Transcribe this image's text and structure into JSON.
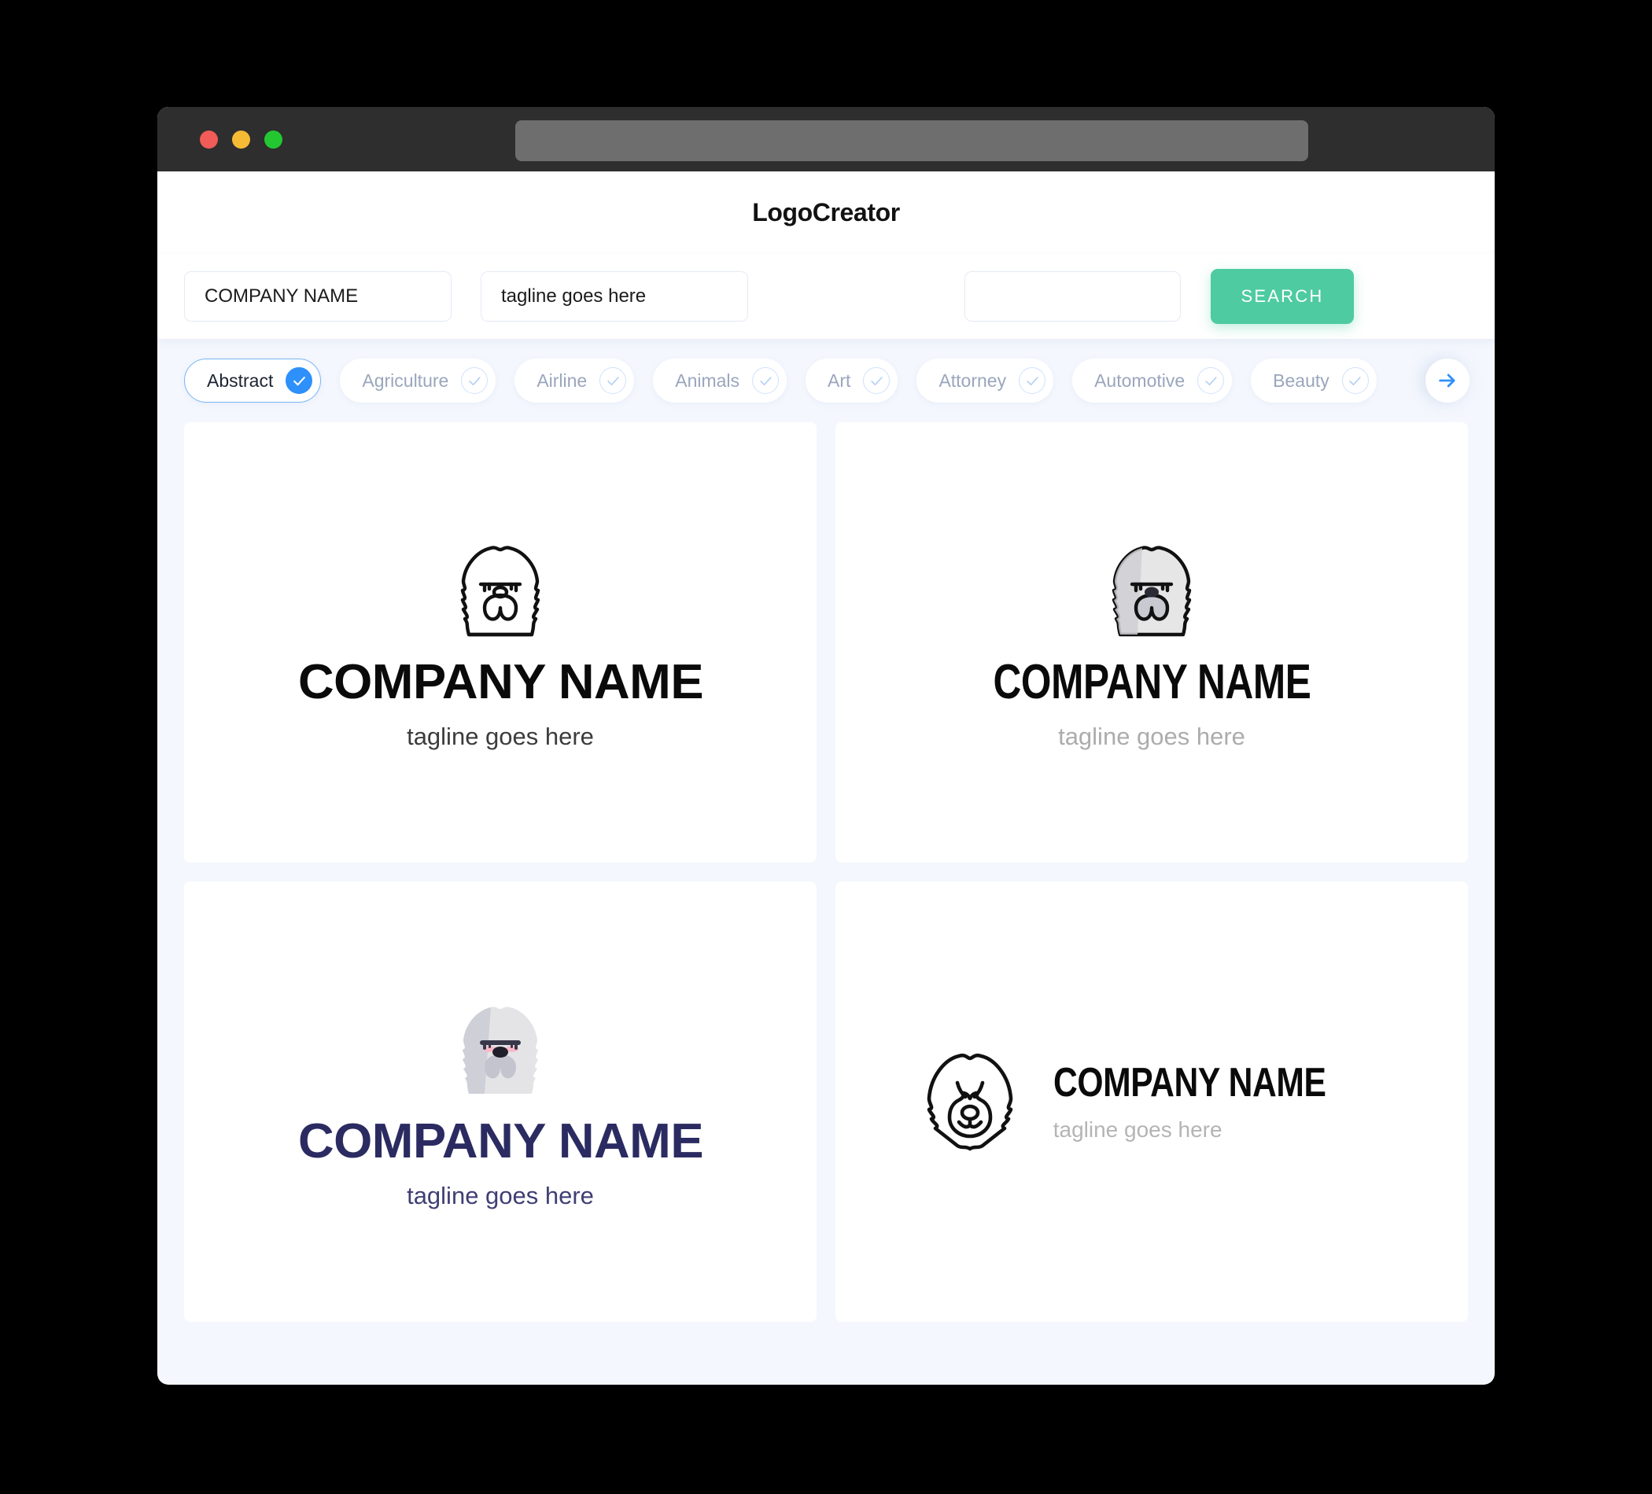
{
  "window": {
    "traffic_lights": [
      "close-red",
      "minimize-yellow",
      "maximize-green"
    ],
    "url_bar_value": ""
  },
  "header": {
    "app_title": "LogoCreator"
  },
  "search": {
    "company_value": "COMPANY NAME",
    "company_placeholder": "COMPANY NAME",
    "tagline_value": "tagline goes here",
    "tagline_placeholder": "tagline goes here",
    "extra_value": "",
    "extra_placeholder": "",
    "search_button_label": "SEARCH",
    "search_button_color": "#4ECBA0"
  },
  "categories": {
    "accent_color": "#2E90FA",
    "next_icon": "arrow-right-icon",
    "items": [
      {
        "label": "Abstract",
        "selected": true
      },
      {
        "label": "Agriculture",
        "selected": false
      },
      {
        "label": "Airline",
        "selected": false
      },
      {
        "label": "Animals",
        "selected": false
      },
      {
        "label": "Art",
        "selected": false
      },
      {
        "label": "Attorney",
        "selected": false
      },
      {
        "label": "Automotive",
        "selected": false
      },
      {
        "label": "Beauty",
        "selected": false
      }
    ]
  },
  "results": [
    {
      "id": 1,
      "layout": "stacked",
      "icon": "sheepdog-outline-icon",
      "name": "COMPANY NAME",
      "tagline": "tagline goes here",
      "name_color": "#0A0A0A",
      "tagline_color": "#3C3C3C"
    },
    {
      "id": 2,
      "layout": "stacked",
      "icon": "sheepdog-grey-filled-icon",
      "name": "COMPANY NAME",
      "tagline": "tagline goes here",
      "name_color": "#0A0A0A",
      "tagline_color": "#ACACAC"
    },
    {
      "id": 3,
      "layout": "stacked",
      "icon": "sheepdog-flat-icon",
      "name": "COMPANY NAME",
      "tagline": "tagline goes here",
      "name_color": "#2B2B62",
      "tagline_color": "#3F3F74"
    },
    {
      "id": 4,
      "layout": "horizontal",
      "icon": "sheepdog-face-outline-icon",
      "name": "COMPANY NAME",
      "tagline": "tagline goes here",
      "name_color": "#0A0A0A",
      "tagline_color": "#B4B4B4"
    }
  ]
}
